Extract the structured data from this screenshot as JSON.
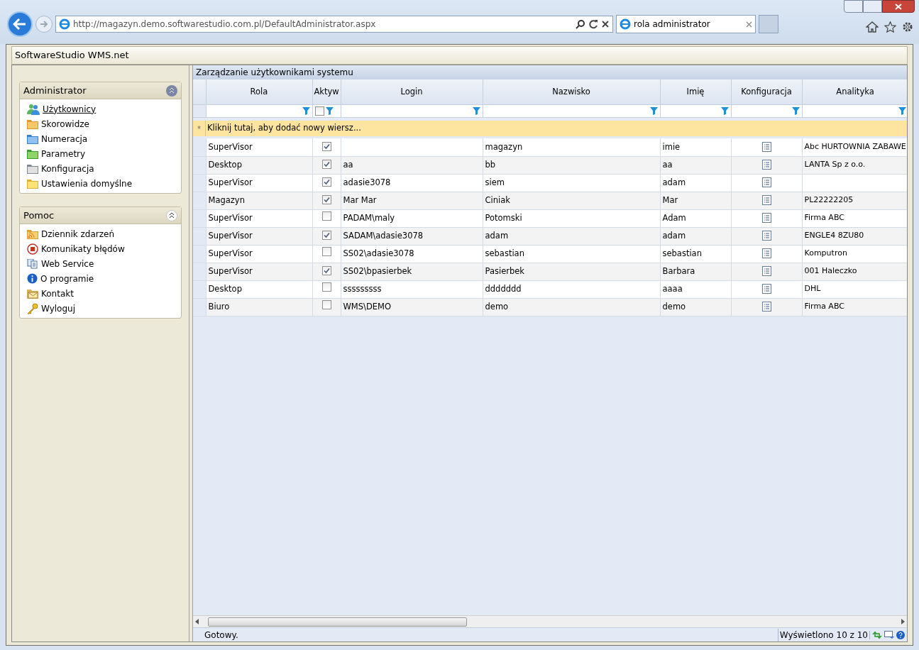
{
  "browser": {
    "url": "http://magazyn.demo.softwarestudio.com.pl/DefaultAdministrator.aspx",
    "tab": "rola administrator"
  },
  "app_title": "SoftwareStudio WMS.net",
  "sidebar": [
    {
      "title": "Administrator",
      "items": [
        {
          "label": "Użytkownicy",
          "selected": true
        },
        {
          "label": "Skorowidze",
          "selected": false
        },
        {
          "label": "Numeracja",
          "selected": false
        },
        {
          "label": "Parametry",
          "selected": false
        },
        {
          "label": "Konfiguracja",
          "selected": false
        },
        {
          "label": "Ustawienia domyślne",
          "selected": false
        }
      ]
    },
    {
      "title": "Pomoc",
      "items": [
        {
          "label": "Dziennik zdarzeń",
          "selected": false
        },
        {
          "label": "Komunikaty błędów",
          "selected": false
        },
        {
          "label": "Web Service",
          "selected": false
        },
        {
          "label": "O programie",
          "selected": false
        },
        {
          "label": "Kontakt",
          "selected": false
        },
        {
          "label": "Wyloguj",
          "selected": false
        }
      ]
    }
  ],
  "grid": {
    "title": "Zarządzanie użytkownikami systemu",
    "columns": [
      "Rola",
      "Aktyw",
      "Login",
      "Nazwisko",
      "Imię",
      "Konfiguracja",
      "Analityka"
    ],
    "filter_active_checked": false,
    "new_row_marker": "*",
    "new_row": "Kliknij tutaj, aby dodać nowy wiersz...",
    "rows": [
      {
        "rola": "SuperVisor",
        "active": true,
        "login": "",
        "nazwisko": "magazyn",
        "imie": "imie",
        "analityka": "Abc HURTOWNIA ZABAWE"
      },
      {
        "rola": "Desktop",
        "active": true,
        "login": "aa",
        "nazwisko": "bb",
        "imie": "aa",
        "analityka": "LANTA Sp z o.o."
      },
      {
        "rola": "SuperVisor",
        "active": true,
        "login": "adasie3078",
        "nazwisko": "siem",
        "imie": "adam",
        "analityka": ""
      },
      {
        "rola": "Magazyn",
        "active": true,
        "login": "Mar Mar",
        "nazwisko": "Ciniak",
        "imie": "Mar",
        "analityka": "PL22222205"
      },
      {
        "rola": "SuperVisor",
        "active": false,
        "login": "PADAM\\maly",
        "nazwisko": "Potomski",
        "imie": "Adam",
        "analityka": "Firma ABC"
      },
      {
        "rola": "SuperVisor",
        "active": true,
        "login": "SADAM\\adasie3078",
        "nazwisko": "adam",
        "imie": "adam",
        "analityka": "ENGLE4 8ZU80"
      },
      {
        "rola": "SuperVisor",
        "active": false,
        "login": "SS02\\adasie3078",
        "nazwisko": "sebastian",
        "imie": "sebastian",
        "analityka": "Komputron"
      },
      {
        "rola": "SuperVisor",
        "active": true,
        "login": "SS02\\bpasierbek",
        "nazwisko": "Pasierbek",
        "imie": "Barbara",
        "analityka": "001 Haleczko"
      },
      {
        "rola": "Desktop",
        "active": false,
        "login": "sssssssss",
        "nazwisko": "ddddddd",
        "imie": "aaaa",
        "analityka": "DHL"
      },
      {
        "rola": "Biuro",
        "active": false,
        "login": "WMS\\DEMO",
        "nazwisko": "demo",
        "imie": "demo",
        "analityka": "Firma ABC"
      }
    ]
  },
  "status": {
    "text": "Gotowy.",
    "count": "Wyświetlono 10 z 10"
  }
}
